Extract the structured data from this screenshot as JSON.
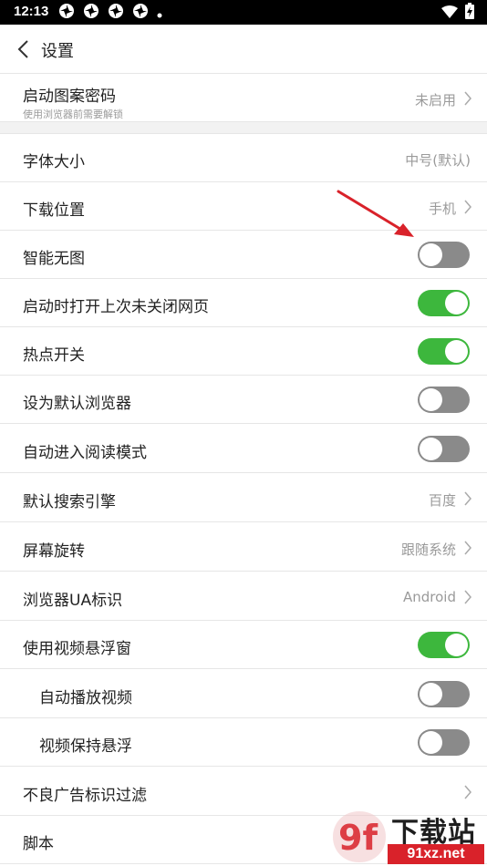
{
  "status_bar": {
    "time": "12:13",
    "icons": [
      "pinwheel-icon",
      "pinwheel-icon",
      "pinwheel-icon",
      "pinwheel-icon",
      "dot-icon",
      "wifi-icon",
      "battery-charging-icon"
    ]
  },
  "header": {
    "back_icon": "chevron-left-icon",
    "title": "设置"
  },
  "settings": {
    "pattern_lock": {
      "label": "启动图案密码",
      "sublabel": "使用浏览器前需要解锁",
      "value": "未启用"
    },
    "font_size": {
      "label": "字体大小",
      "value": "中号(默认)"
    },
    "download_location": {
      "label": "下载位置",
      "value": "手机"
    },
    "smart_no_image": {
      "label": "智能无图",
      "enabled": false
    },
    "restore_tabs": {
      "label": "启动时打开上次未关闭网页",
      "enabled": true
    },
    "hotspot": {
      "label": "热点开关",
      "enabled": true
    },
    "default_browser": {
      "label": "设为默认浏览器",
      "enabled": false
    },
    "auto_reading_mode": {
      "label": "自动进入阅读模式",
      "enabled": false
    },
    "search_engine": {
      "label": "默认搜索引擎",
      "value": "百度"
    },
    "screen_rotation": {
      "label": "屏幕旋转",
      "value": "跟随系统"
    },
    "user_agent": {
      "label": "浏览器UA标识",
      "value": "Android"
    },
    "floating_video": {
      "label": "使用视频悬浮窗",
      "enabled": true
    },
    "autoplay_video": {
      "label": "自动播放视频",
      "enabled": false
    },
    "keep_video_floating": {
      "label": "视频保持悬浮",
      "enabled": false
    },
    "ad_filter": {
      "label": "不良广告标识过滤"
    },
    "scripts": {
      "label": "脚本"
    }
  },
  "watermark": {
    "brand": "下载站",
    "domain": "91xz.net",
    "logo_text": "9f"
  },
  "colors": {
    "toggle_on": "#3db73d",
    "toggle_off": "#8a8a8a",
    "annotation_arrow": "#d9222a",
    "watermark_red": "#d9222a"
  }
}
